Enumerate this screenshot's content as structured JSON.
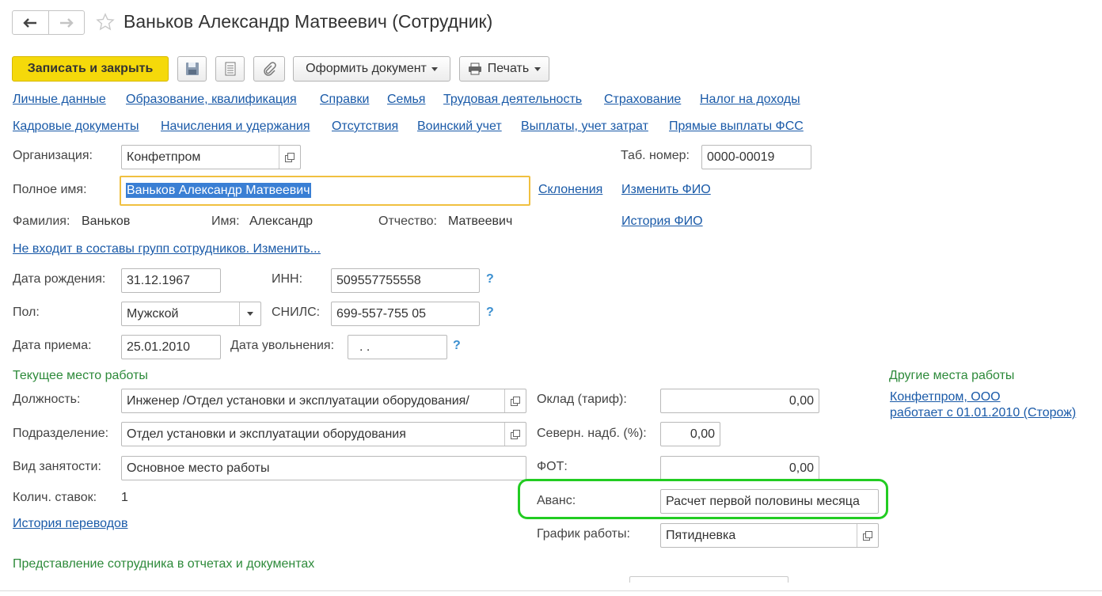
{
  "window": {
    "title": "Ваньков Александр Матвеевич (Сотрудник)"
  },
  "toolbar": {
    "save_close": "Записать и закрыть",
    "oformit": "Оформить документ",
    "print": "Печать"
  },
  "tabs_row1": [
    "Личные данные",
    "Образование, квалификация",
    "Справки",
    "Семья",
    "Трудовая деятельность",
    "Страхование",
    "Налог на доходы"
  ],
  "tabs_row2": [
    "Кадровые документы",
    "Начисления и удержания",
    "Отсутствия",
    "Воинский учет",
    "Выплаты, учет затрат",
    "Прямые выплаты ФСС"
  ],
  "org": {
    "label": "Организация:",
    "value": "Конфетпром"
  },
  "tab_num": {
    "label": "Таб. номер:",
    "value": "0000-00019"
  },
  "full_name": {
    "label": "Полное имя:",
    "value": "Ваньков Александр Матвеевич",
    "declensions": "Склонения",
    "change_fio": "Изменить ФИО",
    "history_fio": "История ФИО"
  },
  "surname": {
    "label": "Фамилия:",
    "value": "Ваньков"
  },
  "name": {
    "label": "Имя:",
    "value": "Александр"
  },
  "patronymic": {
    "label": "Отчество:",
    "value": "Матвеевич"
  },
  "groups_link": "Не входит в составы групп сотрудников. Изменить...",
  "birth": {
    "label": "Дата рождения:",
    "value": "31.12.1967"
  },
  "inn": {
    "label": "ИНН:",
    "value": "509557755558"
  },
  "gender": {
    "label": "Пол:",
    "value": "Мужской"
  },
  "snils": {
    "label": "СНИЛС:",
    "value": "699-557-755 05"
  },
  "hire": {
    "label": "Дата приема:",
    "value": "25.01.2010"
  },
  "dismiss": {
    "label": "Дата увольнения:",
    "value": " .  ."
  },
  "qmark": "?",
  "current_work": {
    "title": "Текущее место работы"
  },
  "position": {
    "label": "Должность:",
    "value": "Инженер /Отдел установки и эксплуатации оборудования/"
  },
  "department": {
    "label": "Подразделение:",
    "value": "Отдел установки и эксплуатации оборудования"
  },
  "employment": {
    "label": "Вид занятости:",
    "value": "Основное место работы"
  },
  "rates": {
    "label": "Колич. ставок:",
    "value": "1"
  },
  "transfer_history": "История переводов",
  "salary": {
    "label": "Оклад (тариф):",
    "value": "0,00"
  },
  "north": {
    "label": "Северн. надб. (%):",
    "value": "0,00"
  },
  "fot": {
    "label": "ФОТ:",
    "value": "0,00"
  },
  "advance": {
    "label": "Аванс:",
    "value": "Расчет первой половины месяца"
  },
  "schedule": {
    "label": "График работы:",
    "value": "Пятидневка"
  },
  "other_work": {
    "title": "Другие места работы",
    "org_link": "Конфетпром, ООО",
    "since_link": "работает с 01.01.2010 (Сторож)"
  },
  "representation": {
    "title": "Представление сотрудника в отчетах и документах"
  },
  "colors": {
    "accent_yellow": "#f5d90a",
    "link": "#1a5aa8",
    "green_title": "#2d8a3a",
    "highlight_green": "#22cc22",
    "focus_orange": "#f0c040"
  }
}
